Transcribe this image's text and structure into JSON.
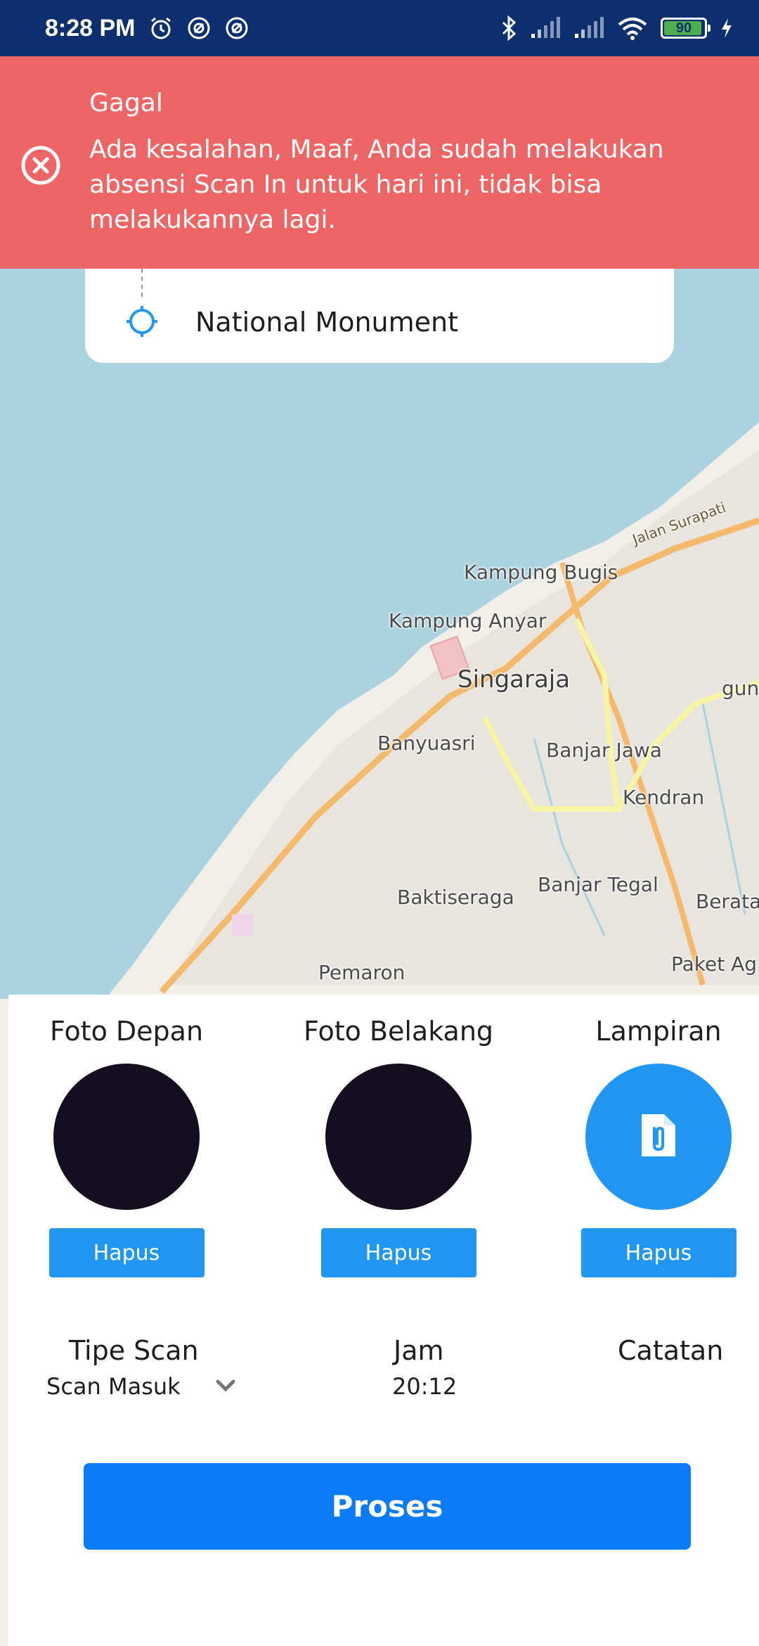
{
  "status_bar": {
    "time": "8:28 PM",
    "battery": "90"
  },
  "error_banner": {
    "title": "Gagal",
    "message": "Ada kesalahan, Maaf, Anda sudah melakukan absensi Scan In untuk hari ini, tidak bisa melakukannya lagi."
  },
  "location": {
    "name": "National Monument"
  },
  "map": {
    "labels": {
      "jalan_surapati": "Jalan Surapati",
      "kampung_bugis": "Kampung Bugis",
      "kampung_anyar": "Kampung Anyar",
      "singaraja": "Singaraja",
      "gun": "gun",
      "banyuasri": "Banyuasri",
      "banjar_jawa": "Banjar Jawa",
      "kendran": "Kendran",
      "baktiseraga": "Baktiseraga",
      "banjar_tegal": "Banjar Tegal",
      "berata": "Berata",
      "paket_ag": "Paket Ag",
      "pemaron": "Pemaron"
    }
  },
  "media": {
    "foto_depan": {
      "title": "Foto Depan",
      "button": "Hapus"
    },
    "foto_belakang": {
      "title": "Foto Belakang",
      "button": "Hapus"
    },
    "lampiran": {
      "title": "Lampiran",
      "button": "Hapus",
      "icon": "attachment-file-icon"
    }
  },
  "form": {
    "tipe_scan_label": "Tipe Scan",
    "tipe_scan_value": "Scan Masuk",
    "jam_label": "Jam",
    "jam_value": "20:12",
    "catatan_label": "Catatan"
  },
  "proses_button": "Proses",
  "colors": {
    "status_bar": "#0d2f6e",
    "error": "#ee6565",
    "accent": "#2196f3",
    "primary_button": "#0a7af5",
    "water": "#aad3df",
    "land": "#f2efe9"
  }
}
